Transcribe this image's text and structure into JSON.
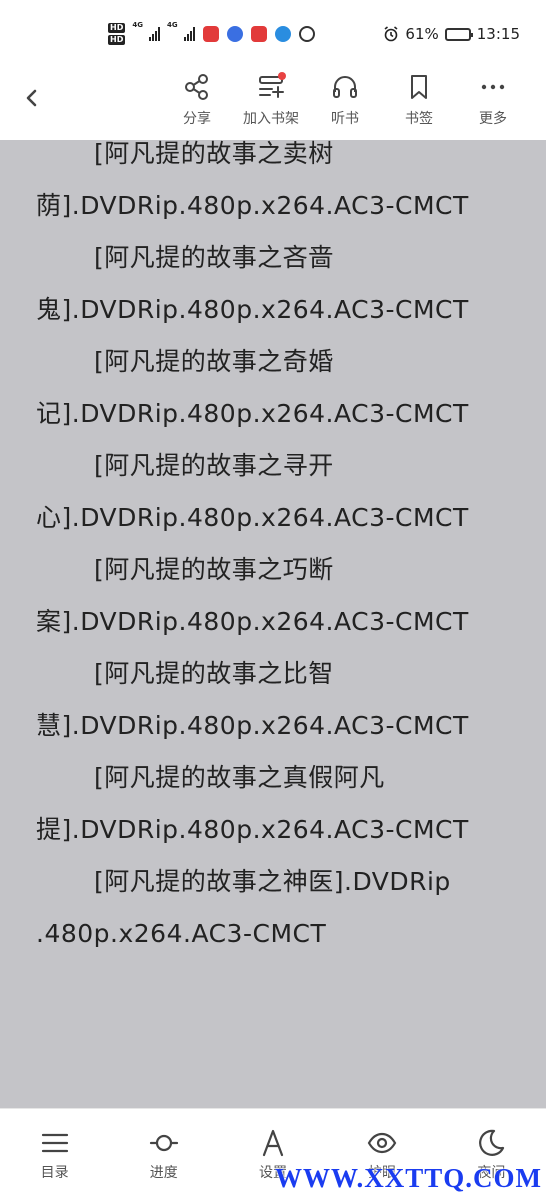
{
  "status_bar": {
    "hd1": "HD",
    "hd2": "HD",
    "net1": "4G",
    "net2": "4G",
    "battery_text": "61%",
    "battery_level": 0.61,
    "time": "13:15"
  },
  "toolbar": {
    "back_icon": "chevron-left-icon",
    "actions": [
      {
        "label": "分享",
        "icon": "share-icon"
      },
      {
        "label": "加入书架",
        "icon": "add-bookshelf-icon"
      },
      {
        "label": "听书",
        "icon": "headphones-icon"
      },
      {
        "label": "书签",
        "icon": "bookmark-icon"
      },
      {
        "label": "更多",
        "icon": "more-icon"
      }
    ]
  },
  "content": {
    "paragraphs": [
      "[阿凡提的故事之卖树荫].DVDRip.480p.x264.AC3-CMCT",
      "[阿凡提的故事之吝啬鬼].DVDRip.480p.x264.AC3-CMCT",
      "[阿凡提的故事之奇婚记].DVDRip.480p.x264.AC3-CMCT",
      "[阿凡提的故事之寻开心].DVDRip.480p.x264.AC3-CMCT",
      "[阿凡提的故事之巧断案].DVDRip.480p.x264.AC3-CMCT",
      "[阿凡提的故事之比智慧].DVDRip.480p.x264.AC3-CMCT",
      "[阿凡提的故事之真假阿凡提].DVDRip.480p.x264.AC3-CMCT",
      "[阿凡提的故事之神医].DVDRip .480p.x264.AC3-CMCT"
    ]
  },
  "bottom_bar": {
    "items": [
      {
        "label": "目录",
        "icon": "menu-list-icon"
      },
      {
        "label": "进度",
        "icon": "progress-icon"
      },
      {
        "label": "设置",
        "icon": "font-settings-icon"
      },
      {
        "label": "护眼",
        "icon": "eye-icon"
      },
      {
        "label": "夜间",
        "icon": "moon-icon"
      }
    ]
  },
  "watermark": "WWW.XXTTQ.COM",
  "colors": {
    "background": "#c4c4c8",
    "text": "#222222",
    "badge_red": "#e84242",
    "watermark_blue": "#1a3cf0"
  }
}
